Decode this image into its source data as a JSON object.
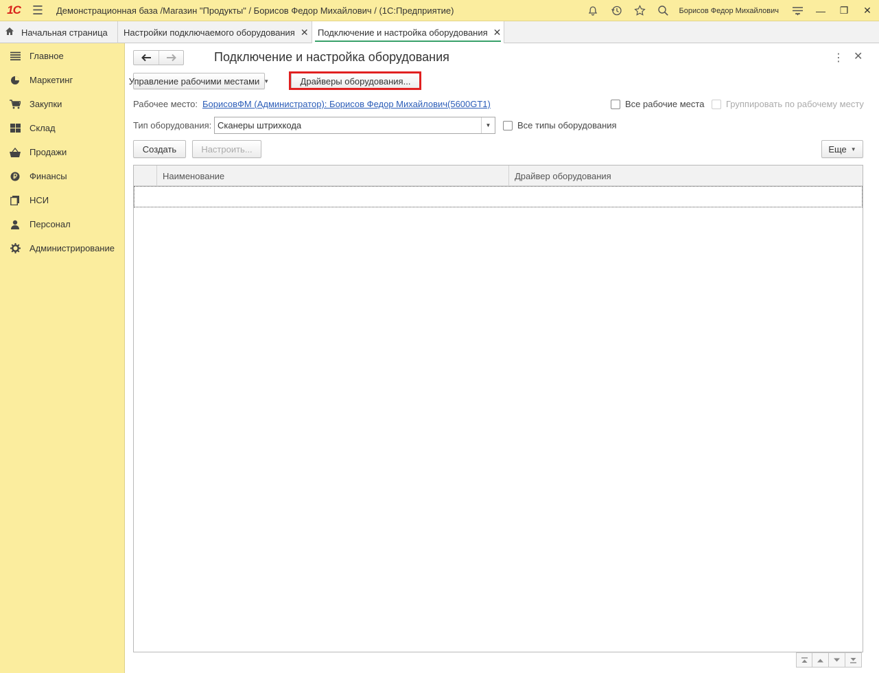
{
  "titlebar": {
    "logo": "1С",
    "title": "Демонстрационная база /Магазин \"Продукты\" / Борисов Федор Михайлович /  (1С:Предприятие)",
    "user": "Борисов Федор Михайлович",
    "icons": [
      "bell-icon",
      "history-icon",
      "star-icon",
      "search-icon",
      "settings-menu-icon"
    ]
  },
  "tabs": [
    {
      "label": "Начальная страница"
    },
    {
      "label": "Настройки подключаемого оборудования"
    },
    {
      "label": "Подключение и настройка оборудования",
      "active": true
    }
  ],
  "sidebar": {
    "items": [
      {
        "label": "Главное",
        "icon": "menu-lines-icon"
      },
      {
        "label": "Маркетинг",
        "icon": "pie-chart-icon"
      },
      {
        "label": "Закупки",
        "icon": "cart-icon"
      },
      {
        "label": "Склад",
        "icon": "grid-icon"
      },
      {
        "label": "Продажи",
        "icon": "basket-icon"
      },
      {
        "label": "Финансы",
        "icon": "ruble-icon"
      },
      {
        "label": "НСИ",
        "icon": "catalog-icon"
      },
      {
        "label": "Персонал",
        "icon": "person-icon"
      },
      {
        "label": "Администрирование",
        "icon": "gear-icon"
      }
    ]
  },
  "form": {
    "title": "Подключение и настройка оборудования",
    "manage_workplaces_label": "Управление рабочими местами",
    "drivers_label": "Драйверы оборудования...",
    "workplace_label": "Рабочее место:",
    "workplace_value": "БорисовФМ (Администратор): Борисов Федор Михайлович(5600GT1)",
    "all_workplaces_label": "Все рабочие места",
    "group_by_workplace_label": "Группировать по рабочему месту",
    "equipment_type_label": "Тип оборудования:",
    "equipment_type_value": "Сканеры штрихкода",
    "all_types_label": "Все типы оборудования",
    "create_label": "Создать",
    "configure_label": "Настроить...",
    "more_label": "Еще"
  },
  "table": {
    "columns": [
      "Наименование",
      "Драйвер оборудования"
    ],
    "rows": []
  },
  "colors": {
    "sidebar_bg": "#fbed9e",
    "highlight": "#e02020",
    "link": "#2b5db8",
    "active_tab_underline": "#38a06a"
  }
}
